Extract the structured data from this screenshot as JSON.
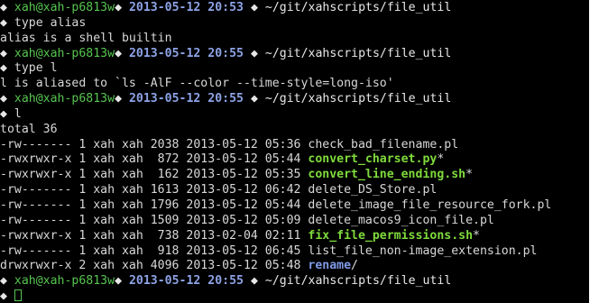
{
  "colors": {
    "background": "#000000",
    "text": "#d8d8d8",
    "prompt_user": "#56c54f",
    "prompt_timestamp": "#8da3e6",
    "executable": "#7fdb3c",
    "directory": "#7f9ae6"
  },
  "prompt": {
    "marker": "◆",
    "user_host": "xah@xah-p6813w",
    "cwd": "~/git/xahscripts/file_util"
  },
  "session": [
    {
      "type": "prompt",
      "time": "2013-05-12 20:53"
    },
    {
      "type": "command",
      "text": "type alias"
    },
    {
      "type": "output",
      "text": "alias is a shell builtin"
    },
    {
      "type": "prompt",
      "time": "2013-05-12 20:55"
    },
    {
      "type": "command",
      "text": "type l"
    },
    {
      "type": "output",
      "text": "l is aliased to `ls -AlF --color --time-style=long-iso'"
    },
    {
      "type": "prompt",
      "time": "2013-05-12 20:55"
    },
    {
      "type": "command",
      "text": "l"
    },
    {
      "type": "output",
      "text": "total 36"
    },
    {
      "type": "file",
      "info": "-rw------- 1 xah xah 2038 2013-05-12 05:36 ",
      "name": "check_bad_filename.pl",
      "suffix": "",
      "kind": "plain"
    },
    {
      "type": "file",
      "info": "-rwxrwxr-x 1 xah xah  872 2013-05-12 05:44 ",
      "name": "convert_charset.py",
      "suffix": "*",
      "kind": "exec"
    },
    {
      "type": "file",
      "info": "-rwxrwxr-x 1 xah xah  162 2013-05-12 05:35 ",
      "name": "convert_line_ending.sh",
      "suffix": "*",
      "kind": "exec"
    },
    {
      "type": "file",
      "info": "-rw------- 1 xah xah 1613 2013-05-12 06:42 ",
      "name": "delete_DS_Store.pl",
      "suffix": "",
      "kind": "plain"
    },
    {
      "type": "file",
      "info": "-rw------- 1 xah xah 1796 2013-05-12 05:44 ",
      "name": "delete_image_file_resource_fork.pl",
      "suffix": "",
      "kind": "plain"
    },
    {
      "type": "file",
      "info": "-rw------- 1 xah xah 1509 2013-05-12 05:09 ",
      "name": "delete_macos9_icon_file.pl",
      "suffix": "",
      "kind": "plain"
    },
    {
      "type": "file",
      "info": "-rwxrwxr-x 1 xah xah  738 2013-02-04 02:11 ",
      "name": "fix_file_permissions.sh",
      "suffix": "*",
      "kind": "exec"
    },
    {
      "type": "file",
      "info": "-rw------- 1 xah xah  918 2013-05-12 06:45 ",
      "name": "list_file_non-image_extension.pl",
      "suffix": "",
      "kind": "plain"
    },
    {
      "type": "file",
      "info": "drwxrwxr-x 2 xah xah 4096 2013-05-12 05:48 ",
      "name": "rename",
      "suffix": "/",
      "kind": "dir"
    },
    {
      "type": "prompt",
      "time": "2013-05-12 20:55"
    },
    {
      "type": "command",
      "text": "",
      "cursor": true
    }
  ]
}
